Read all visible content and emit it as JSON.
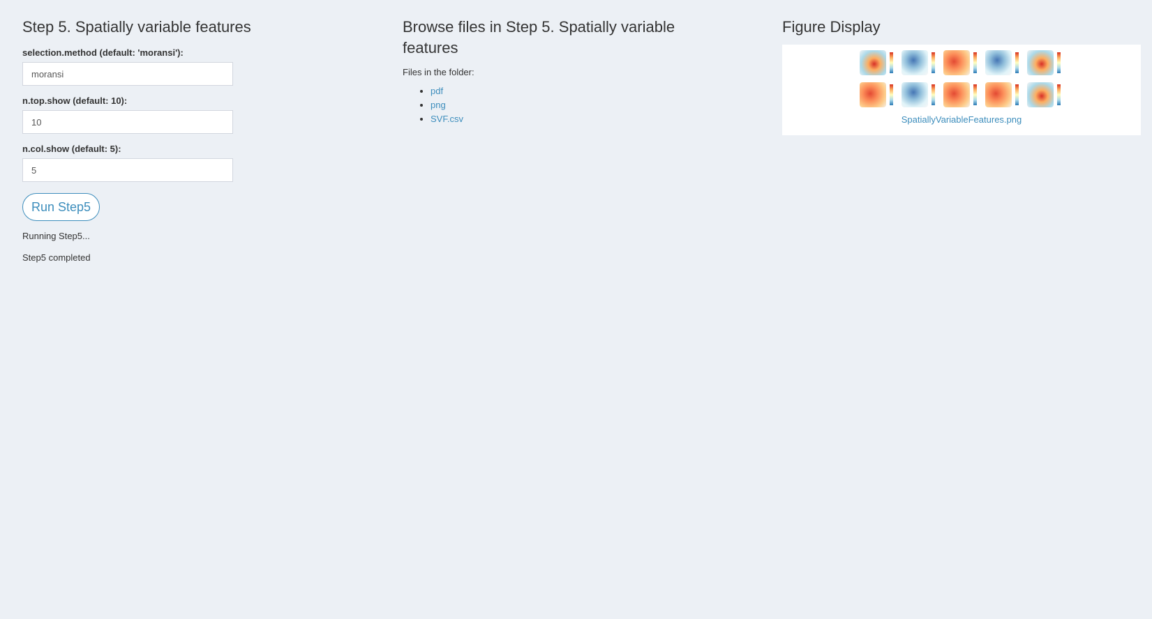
{
  "step_panel": {
    "title": "Step 5. Spatially variable features",
    "fields": [
      {
        "label": "selection.method (default: 'moransi'):",
        "value": "moransi"
      },
      {
        "label": "n.top.show (default: 10):",
        "value": "10"
      },
      {
        "label": "n.col.show (default: 5):",
        "value": "5"
      }
    ],
    "run_button_label": "Run Step5",
    "status_lines": [
      "Running Step5...",
      "Step5 completed"
    ]
  },
  "browse_panel": {
    "title": "Browse files in Step 5. Spatially variable features",
    "files_label": "Files in the folder:",
    "files": [
      "pdf",
      "png",
      "SVF.csv"
    ]
  },
  "figure_panel": {
    "title": "Figure Display",
    "caption": "SpatiallyVariableFeatures.png",
    "thumbnail_icon": "spatial-heatmap-thumbnail"
  },
  "colors": {
    "background": "#ecf0f5",
    "accent": "#3c8dbc"
  }
}
